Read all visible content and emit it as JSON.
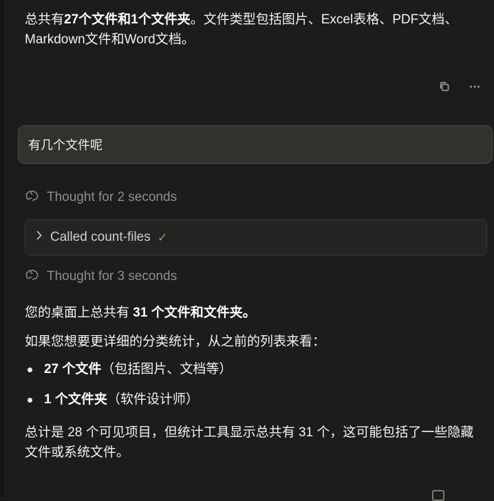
{
  "messages": {
    "first_answer": {
      "prefix": "总共有",
      "bold_a": "27个文件",
      "mid": "和",
      "bold_b": "1个文件夹",
      "suffix": "。文件类型包括图片、Excel表格、PDF文档、Markdown文件和Word文档。"
    },
    "user_question": "有几个文件呢",
    "thought_1": "Thought for 2 seconds",
    "tool_call": {
      "label": "Called count-files",
      "status_glyph": "✓"
    },
    "thought_2": "Thought for 3 seconds",
    "answer": {
      "line1_prefix": "您的桌面上总共有 ",
      "line1_bold": "31 个文件和文件夹",
      "line1_suffix": "。",
      "line2": "如果您想要更详细的分类统计，从之前的列表来看：",
      "bullets": [
        {
          "bold": "27 个文件",
          "rest": "（包括图片、文档等）"
        },
        {
          "bold": "1 个文件夹",
          "rest": "（软件设计师）"
        }
      ],
      "line3": "总计是 28 个可见项目，但统计工具显示总共有 31 个，这可能包括了一些隐藏文件或系统文件。"
    }
  },
  "actions": {
    "copy_icon": "copy-icon",
    "more_icon": "more-icon"
  },
  "colors": {
    "background": "#1c1c1b",
    "user_bubble": "#31312e",
    "tool_call_bg": "#242422",
    "muted_text": "#8f8f8b",
    "check_green": "#6fa86b"
  }
}
